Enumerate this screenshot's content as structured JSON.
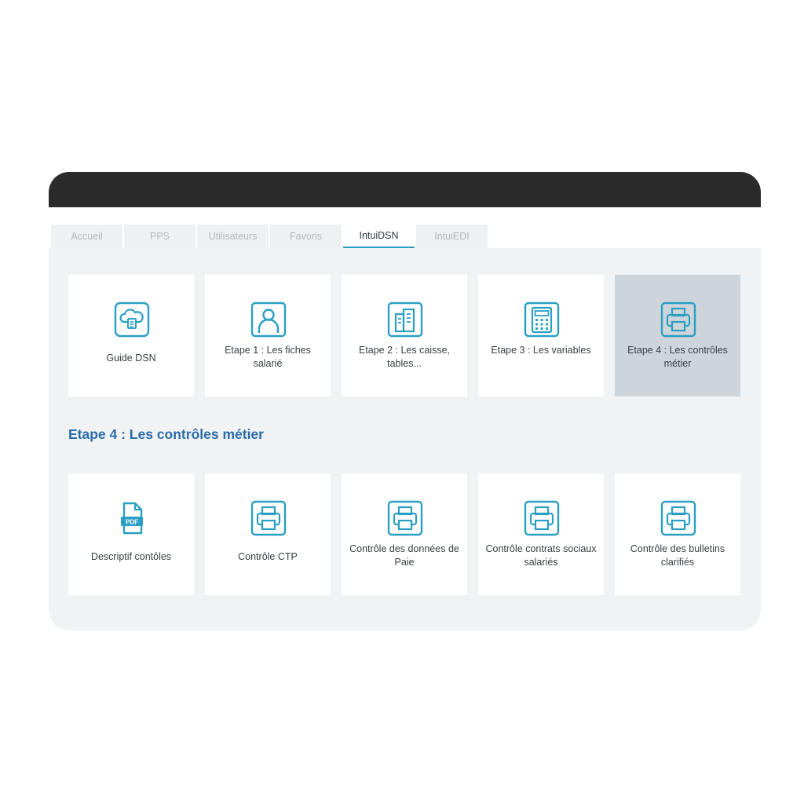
{
  "tabs": [
    {
      "label": "Accueil",
      "active": false
    },
    {
      "label": "PPS",
      "active": false
    },
    {
      "label": "Utilisateurs",
      "active": false
    },
    {
      "label": "Favoris",
      "active": false
    },
    {
      "label": "IntuiDSN",
      "active": true
    },
    {
      "label": "IntuiEDI",
      "active": false
    }
  ],
  "steps": [
    {
      "label": "Guide DSN",
      "icon": "cloud-document-icon",
      "selected": false
    },
    {
      "label": "Etape 1 : Les fiches salarié",
      "icon": "person-icon",
      "selected": false
    },
    {
      "label": "Etape 2 : Les caisse, tables...",
      "icon": "buildings-icon",
      "selected": false
    },
    {
      "label": "Etape 3 : Les variables",
      "icon": "calculator-icon",
      "selected": false
    },
    {
      "label": "Etape 4 : Les contrôles métier",
      "icon": "printer-icon",
      "selected": true
    }
  ],
  "section_title": "Etape 4 : Les contrôles métier",
  "sub_items": [
    {
      "label": "Descriptif contôles",
      "icon": "pdf-file-icon"
    },
    {
      "label": "Contrôle CTP",
      "icon": "printer-icon"
    },
    {
      "label": "Contrôle des données de Paie",
      "icon": "printer-icon"
    },
    {
      "label": "Contrôle contrats sociaux salariés",
      "icon": "printer-icon"
    },
    {
      "label": "Contrôle des bulletins clarifiés",
      "icon": "printer-icon"
    }
  ],
  "colors": {
    "accent": "#2a9fc4",
    "section_title": "#2b6ca9",
    "titlebar": "#2b2b2b",
    "panel_bg": "#f0f2f4",
    "selected_card": "#cdd4da"
  }
}
